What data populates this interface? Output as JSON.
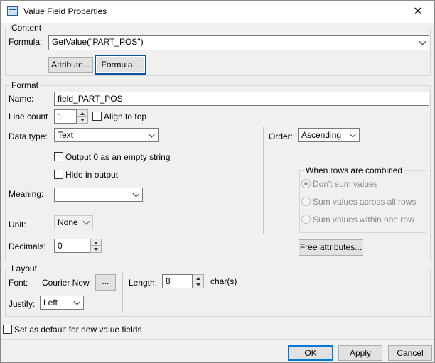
{
  "window": {
    "title": "Value Field Properties",
    "close_symbol": "✕"
  },
  "content": {
    "legend": "Content",
    "formula_label": "Formula:",
    "formula_value": "GetValue(\"PART_POS\")",
    "attribute_button": "Attribute...",
    "formula_button": "Formula..."
  },
  "format": {
    "legend": "Format",
    "name_label": "Name:",
    "name_value": "field_PART_POS",
    "line_count_label": "Line count",
    "line_count_value": "1",
    "align_to_top_label": "Align to top",
    "data_type_label": "Data type:",
    "data_type_value": "Text",
    "output_zero_label": "Output 0 as an empty string",
    "hide_in_output_label": "Hide in output",
    "meaning_label": "Meaning:",
    "meaning_value": "",
    "unit_label": "Unit:",
    "unit_value": "None",
    "decimals_label": "Decimals:",
    "decimals_value": "0",
    "order_label": "Order:",
    "order_value": "Ascending",
    "combined_legend": "When rows are combined",
    "combined_options": [
      "Don't sum values",
      "Sum values across all rows",
      "Sum values within one row"
    ],
    "free_attributes_button": "Free attributes..."
  },
  "layout": {
    "legend": "Layout",
    "font_label": "Font:",
    "font_value": "Courier New",
    "font_button": "...",
    "length_label": "Length:",
    "length_value": "8",
    "length_unit": "char(s)",
    "justify_label": "Justify:",
    "justify_value": "Left"
  },
  "default_checkbox_label": "Set as default for new value fields",
  "buttons": {
    "ok": "OK",
    "apply": "Apply",
    "cancel": "Cancel"
  },
  "colors": {
    "focus_border": "#0f4f9e",
    "default_border": "#0078d7"
  },
  "icons": [
    "app-icon",
    "close-icon",
    "chevron-down-icon",
    "spin-up-icon",
    "spin-down-icon"
  ]
}
